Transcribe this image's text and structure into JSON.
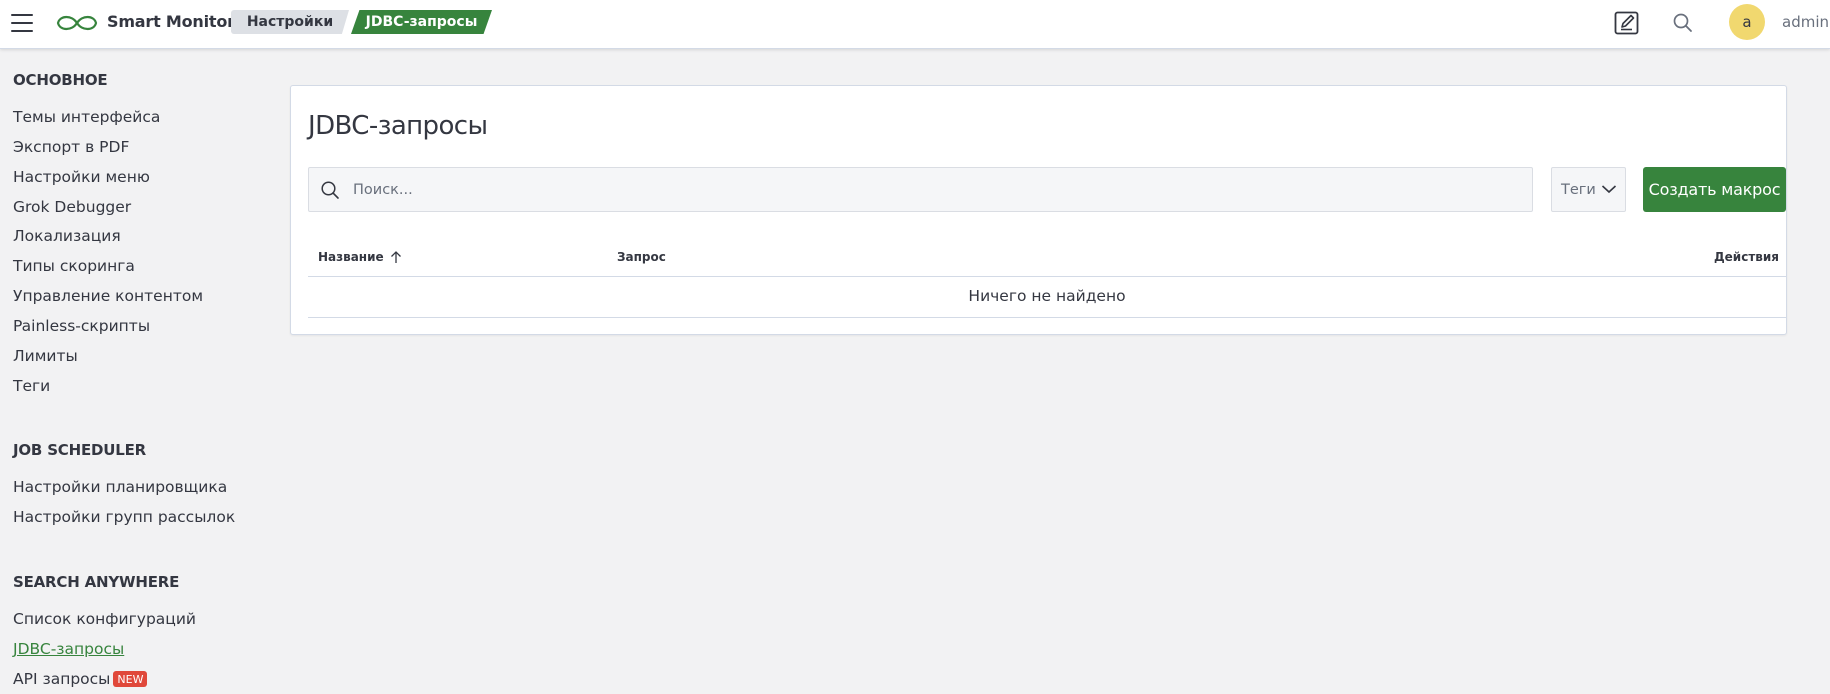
{
  "header": {
    "brand": "Smart Monitor",
    "breadcrumbs": [
      "Настройки",
      "JDBC-запросы"
    ],
    "icons": [
      "menu-icon",
      "edit-icon",
      "search-icon"
    ],
    "avatar_letter": "a",
    "username": "admin"
  },
  "sidebar": {
    "sections": [
      {
        "title": "ОСНОВНОЕ",
        "items": [
          {
            "label": "Темы интерфейса"
          },
          {
            "label": "Экспорт в PDF"
          },
          {
            "label": "Настройки меню"
          },
          {
            "label": "Grok Debugger"
          },
          {
            "label": "Локализация"
          },
          {
            "label": "Типы скоринга"
          },
          {
            "label": "Управление контентом"
          },
          {
            "label": "Painless-скрипты"
          },
          {
            "label": "Лимиты"
          },
          {
            "label": "Теги"
          }
        ]
      },
      {
        "title": "JOB SCHEDULER",
        "items": [
          {
            "label": "Настройки планировщика"
          },
          {
            "label": "Настройки групп рассылок"
          }
        ]
      },
      {
        "title": "SEARCH ANYWHERE",
        "items": [
          {
            "label": "Список конфигураций"
          },
          {
            "label": "JDBC-запросы",
            "active": true
          },
          {
            "label": "API запросы",
            "badge": "NEW"
          }
        ]
      }
    ]
  },
  "main": {
    "title": "JDBC-запросы",
    "search_placeholder": "Поиск...",
    "tags_label": "Теги",
    "create_button": "Создать макрос",
    "columns": [
      "Название",
      "Запрос",
      "Действия"
    ],
    "empty_message": "Ничего не найдено"
  },
  "colors": {
    "accent": "#37843d",
    "badge": "#e0483a",
    "avatar": "#f1d86f",
    "background": "#f2f2f3"
  }
}
